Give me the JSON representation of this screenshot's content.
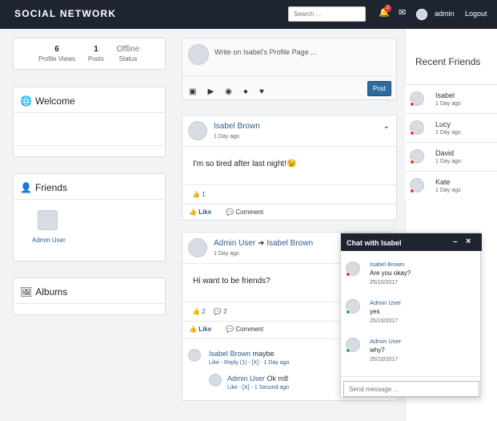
{
  "app": {
    "brand": "SOCIAL NETWORK",
    "search_placeholder": "Search ...",
    "notification_count": "3",
    "username": "admin",
    "logout": "Logout"
  },
  "profile_stats": [
    {
      "value": "6",
      "label": "Profile Views"
    },
    {
      "value": "1",
      "label": "Posts"
    },
    {
      "value": "Offline",
      "label": "Status"
    }
  ],
  "panels": {
    "welcome": "Welcome",
    "friends": "Friends",
    "friend_name": "Admin User",
    "albums": "Albums"
  },
  "composer": {
    "placeholder": "Write on Isabel's Profile Page ...",
    "post_button": "Post"
  },
  "posts": [
    {
      "author": "Isabel Brown",
      "time": "1 Day ago",
      "text": "I'm so tired after last night!😉",
      "likes": "1",
      "like_label": "Like",
      "comment_label": "Comment"
    },
    {
      "author": "Admin User",
      "target": "Isabel Brown",
      "time": "1 Day ago",
      "text": "Hi want to be friends?",
      "likes": "2",
      "comments": "2",
      "like_label": "Like",
      "comment_label": "Comment"
    }
  ],
  "comments": [
    {
      "author": "Isabel Brown",
      "text": "maybe",
      "meta": "Like - Reply (1) - [X] - 1 Day ago"
    },
    {
      "author": "Admin User",
      "text": "Ok m8",
      "meta": "Like - [X] - 1 Second ago"
    }
  ],
  "chat": {
    "title": "Chat with Isabel",
    "minimize": "–",
    "close": "×",
    "input_placeholder": "Send message ...",
    "messages": [
      {
        "author": "Isabel Brown",
        "text": "Are you okay?",
        "date": "25/10/2017"
      },
      {
        "author": "Admin User",
        "text": "yes",
        "date": "25/10/2017"
      },
      {
        "author": "Admin User",
        "text": "why?",
        "date": "25/10/2017"
      }
    ]
  },
  "recent_friends": {
    "title": "Recent Friends",
    "items": [
      {
        "name": "Isabel",
        "time": "1 Day ago"
      },
      {
        "name": "Lucy",
        "time": "1 Day ago"
      },
      {
        "name": "David",
        "time": "1 Day ago"
      },
      {
        "name": "Kate",
        "time": "1 Day ago"
      }
    ]
  }
}
